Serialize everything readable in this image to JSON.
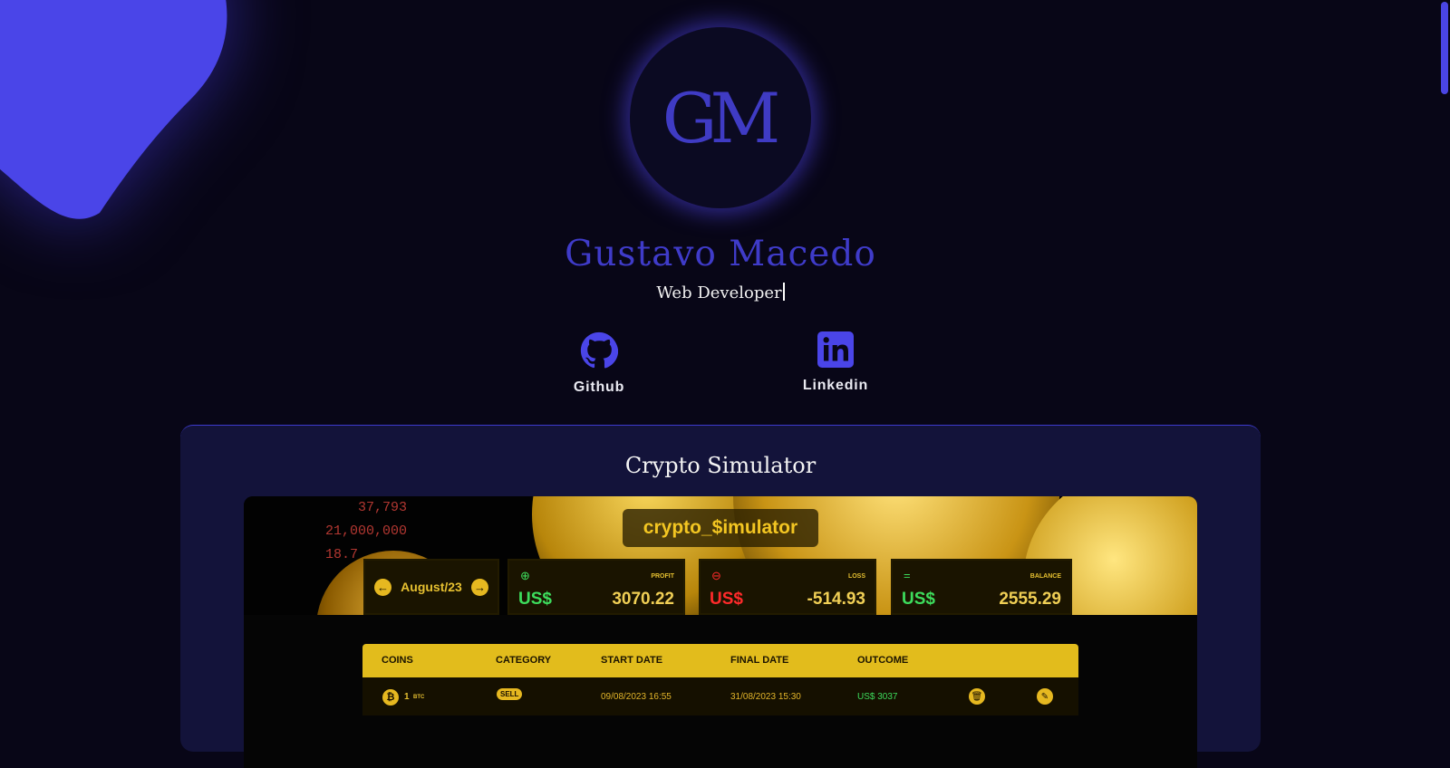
{
  "profile": {
    "initials": "GM",
    "name": "Gustavo Macedo",
    "title": "Web Developer"
  },
  "social": [
    {
      "label": "Github",
      "icon": "github-icon"
    },
    {
      "label": "Linkedin",
      "icon": "linkedin-icon"
    }
  ],
  "project": {
    "title": "Crypto Simulator",
    "preview": {
      "brand": "crypto_$imulator",
      "month": "August/23",
      "stats": [
        {
          "tag": "PROFIT",
          "currency": "US$",
          "value": "3070.22",
          "icon": "plus-circle-icon",
          "color": "#3ddc5c"
        },
        {
          "tag": "LOSS",
          "currency": "US$",
          "value": "-514.93",
          "icon": "minus-circle-icon",
          "color": "#ff2a2a"
        },
        {
          "tag": "BALANCE",
          "currency": "US$",
          "value": "2555.29",
          "icon": "equals-icon",
          "color": "#3ddc5c"
        }
      ],
      "table": {
        "headers": [
          "COINS",
          "CATEGORY",
          "START DATE",
          "FINAL DATE",
          "OUTCOME"
        ],
        "rows": [
          {
            "amount": "1",
            "symbol": "BTC",
            "category": "SELL",
            "start": "09/08/2023 16:55",
            "end": "31/08/2023 15:30",
            "outcome": "US$ 3037"
          }
        ]
      }
    }
  },
  "colors": {
    "accent": "#3f3bc9",
    "background": "#080617",
    "card": "#13133a",
    "gold": "#e2bc1c"
  }
}
